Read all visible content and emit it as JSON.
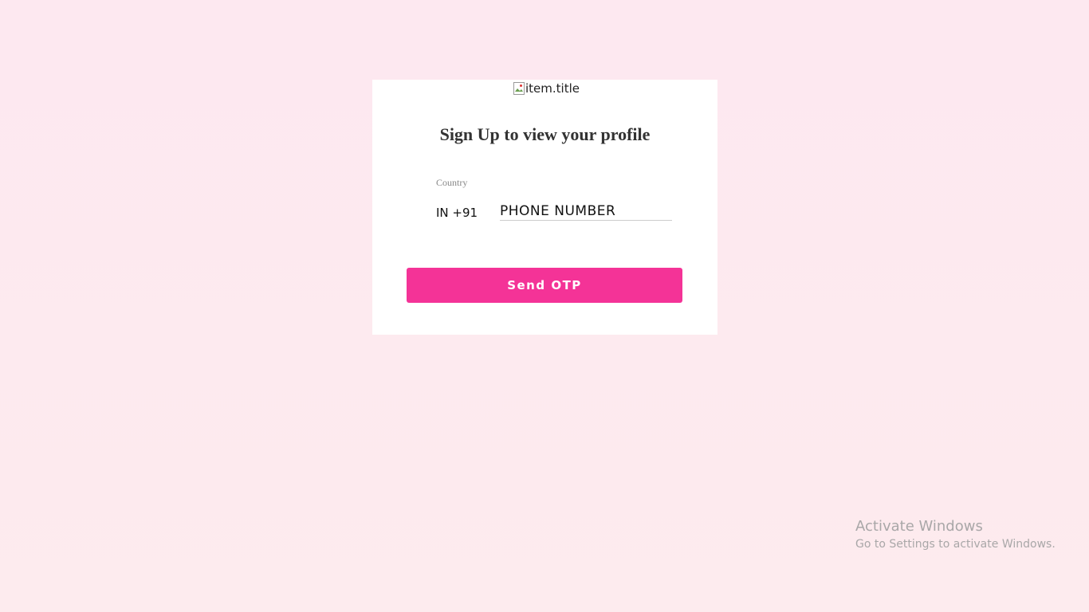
{
  "logo": {
    "alt": "item.title",
    "icon": "broken-image-icon"
  },
  "form": {
    "title": "Sign Up to view your profile",
    "country_label": "Country",
    "country_code": "IN +91",
    "phone_placeholder": "PHONE NUMBER",
    "phone_value": "",
    "submit_label": "Send OTP"
  },
  "watermark": {
    "title": "Activate Windows",
    "subtitle": "Go to Settings to activate Windows."
  },
  "colors": {
    "accent": "#f43397",
    "background": "#fde8f0",
    "card": "#ffffff"
  }
}
